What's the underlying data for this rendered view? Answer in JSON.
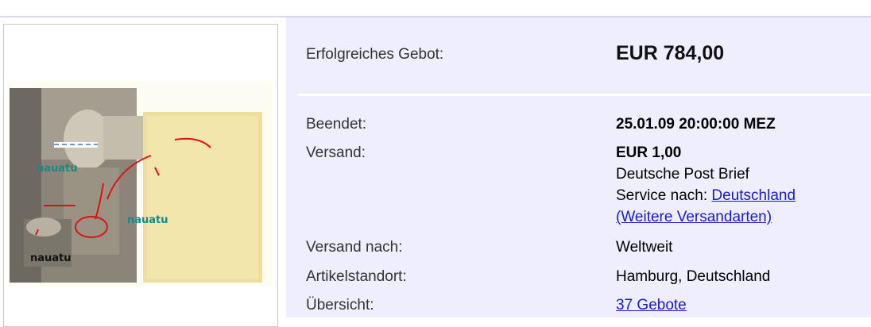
{
  "listing": {
    "winning_bid_label": "Erfolgreiches Gebot:",
    "winning_bid_value": "EUR 784,00",
    "ended_label": "Beendet:",
    "ended_value": "25.01.09 20:00:00 MEZ",
    "shipping_label": "Versand:",
    "shipping_price": "EUR 1,00",
    "shipping_service": "Deutsche Post Brief",
    "service_to_prefix": "Service nach:",
    "service_to_link": "Deutschland",
    "more_shipping_link": "(Weitere Versandarten)",
    "ships_to_label": "Versand nach:",
    "ships_to_value": "Weltweit",
    "location_label": "Artikelstandort:",
    "location_value": "Hamburg, Deutschland",
    "overview_label": "Übersicht:",
    "overview_link": "37 Gebote"
  },
  "photo": {
    "watermark_1": "nauatu",
    "watermark_2": "nauatu",
    "watermark_3": "nauatu"
  },
  "colors": {
    "panel_bg": "#eeeeff",
    "link": "#1a1acc",
    "annotation_red": "#dd1111",
    "watermark_teal": "#138a8a"
  }
}
